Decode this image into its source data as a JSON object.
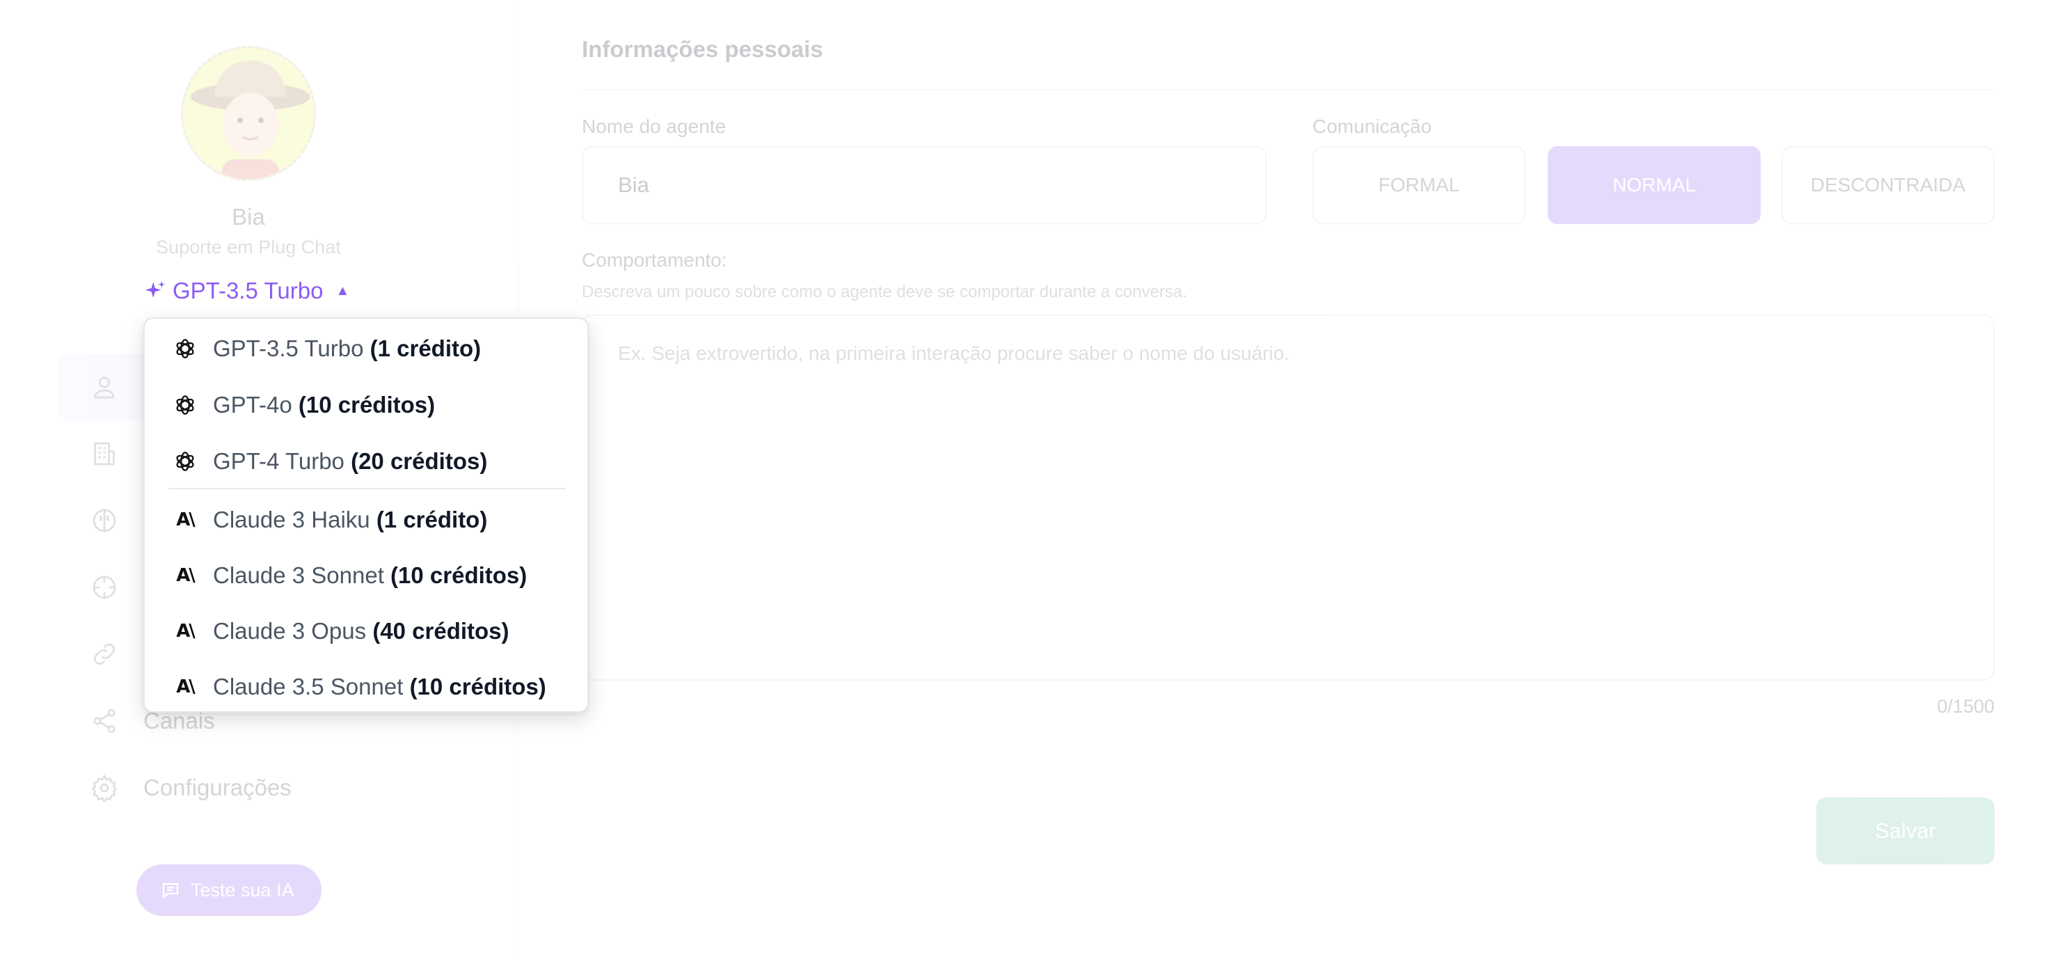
{
  "profile": {
    "name": "Bia",
    "subtitle": "Suporte em Plug Chat"
  },
  "model_selector": {
    "current": "GPT-3.5 Turbo",
    "icon": "sparkle-icon",
    "open": true,
    "options": [
      {
        "name": "GPT-3.5 Turbo",
        "cost": "(1 crédito)",
        "provider_icon": "openai-icon"
      },
      {
        "name": "GPT-4o",
        "cost": "(10 créditos)",
        "provider_icon": "openai-icon"
      },
      {
        "name": "GPT-4 Turbo",
        "cost": "(20 créditos)",
        "provider_icon": "openai-icon"
      },
      {
        "name": "Claude 3 Haiku",
        "cost": "(1 crédito)",
        "provider_icon": "anthropic-icon"
      },
      {
        "name": "Claude 3 Sonnet",
        "cost": "(10 créditos)",
        "provider_icon": "anthropic-icon"
      },
      {
        "name": "Claude 3 Opus",
        "cost": "(40 créditos)",
        "provider_icon": "anthropic-icon"
      },
      {
        "name": "Claude 3.5 Sonnet",
        "cost": "(10 créditos)",
        "provider_icon": "anthropic-icon"
      }
    ],
    "anthropic_glyph": "A\\"
  },
  "sidebar": {
    "items": [
      {
        "label": "",
        "icon": "user-icon",
        "active": true
      },
      {
        "label": "",
        "icon": "building-icon"
      },
      {
        "label": "",
        "icon": "brain-icon"
      },
      {
        "label": "",
        "icon": "crosshair-icon"
      },
      {
        "label": "",
        "icon": "link-icon"
      },
      {
        "label": "Canais",
        "icon": "share-icon"
      },
      {
        "label": "Configurações",
        "icon": "gear-icon"
      }
    ],
    "test_button": {
      "label": "Teste sua IA",
      "icon": "chat-icon"
    }
  },
  "form": {
    "section_title": "Informações pessoais",
    "agent_name_label": "Nome do agente",
    "agent_name_value": "Bia",
    "communication_label": "Comunicação",
    "communication_options": [
      "FORMAL",
      "NORMAL",
      "DESCONTRAIDA"
    ],
    "communication_selected": "NORMAL",
    "behavior_label": "Comportamento:",
    "behavior_help": "Descreva um pouco sobre como o agente deve se comportar durante a conversa.",
    "behavior_placeholder": "Ex. Seja extrovertido, na primeira interação procure saber o nome do usuário.",
    "char_counter": "0/1500",
    "save_label": "Salvar"
  },
  "colors": {
    "accent": "#8b5cf6",
    "save": "#6cc3a8"
  }
}
